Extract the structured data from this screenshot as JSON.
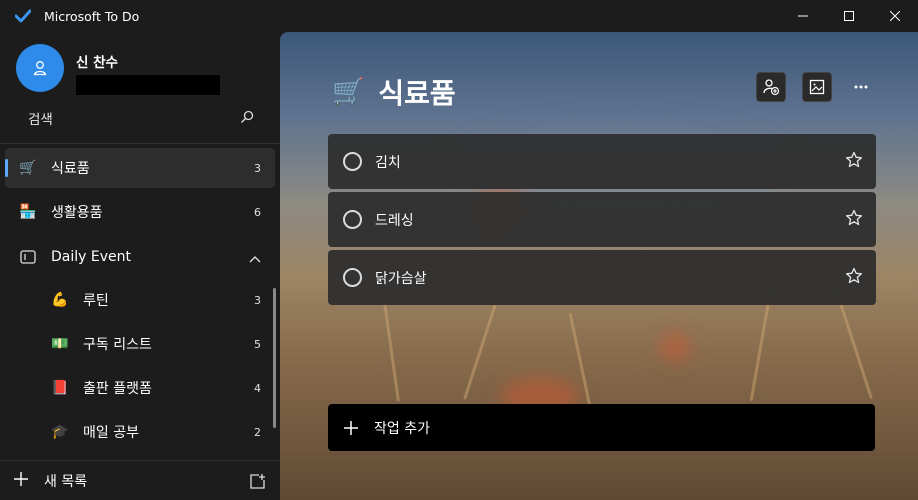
{
  "app": {
    "title": "Microsoft To Do"
  },
  "profile": {
    "name": "신 찬수"
  },
  "search": {
    "label": "검색"
  },
  "sidebar": {
    "items": [
      {
        "icon": "🛒",
        "label": "식료품",
        "count": "3"
      },
      {
        "icon": "🏪",
        "label": "생활용품",
        "count": "6"
      },
      {
        "label": "Daily Event"
      },
      {
        "icon": "💪",
        "label": "루틴",
        "count": "3"
      },
      {
        "icon": "💵",
        "label": "구독 리스트",
        "count": "5"
      },
      {
        "icon": "📕",
        "label": "출판 플랫폼",
        "count": "4"
      },
      {
        "icon": "🎓",
        "label": "매일 공부",
        "count": "2"
      }
    ],
    "new_list_label": "새 목록"
  },
  "main": {
    "title_icon": "🛒",
    "title": "식료품",
    "tasks": [
      {
        "title": "김치"
      },
      {
        "title": "드레싱"
      },
      {
        "title": "닭가슴살"
      }
    ],
    "add_task_label": "작업 추가"
  },
  "colors": {
    "accent": "#2f8bea",
    "selection_bar": "#5fa8ff",
    "sidebar_bg": "#1c1c1c"
  }
}
